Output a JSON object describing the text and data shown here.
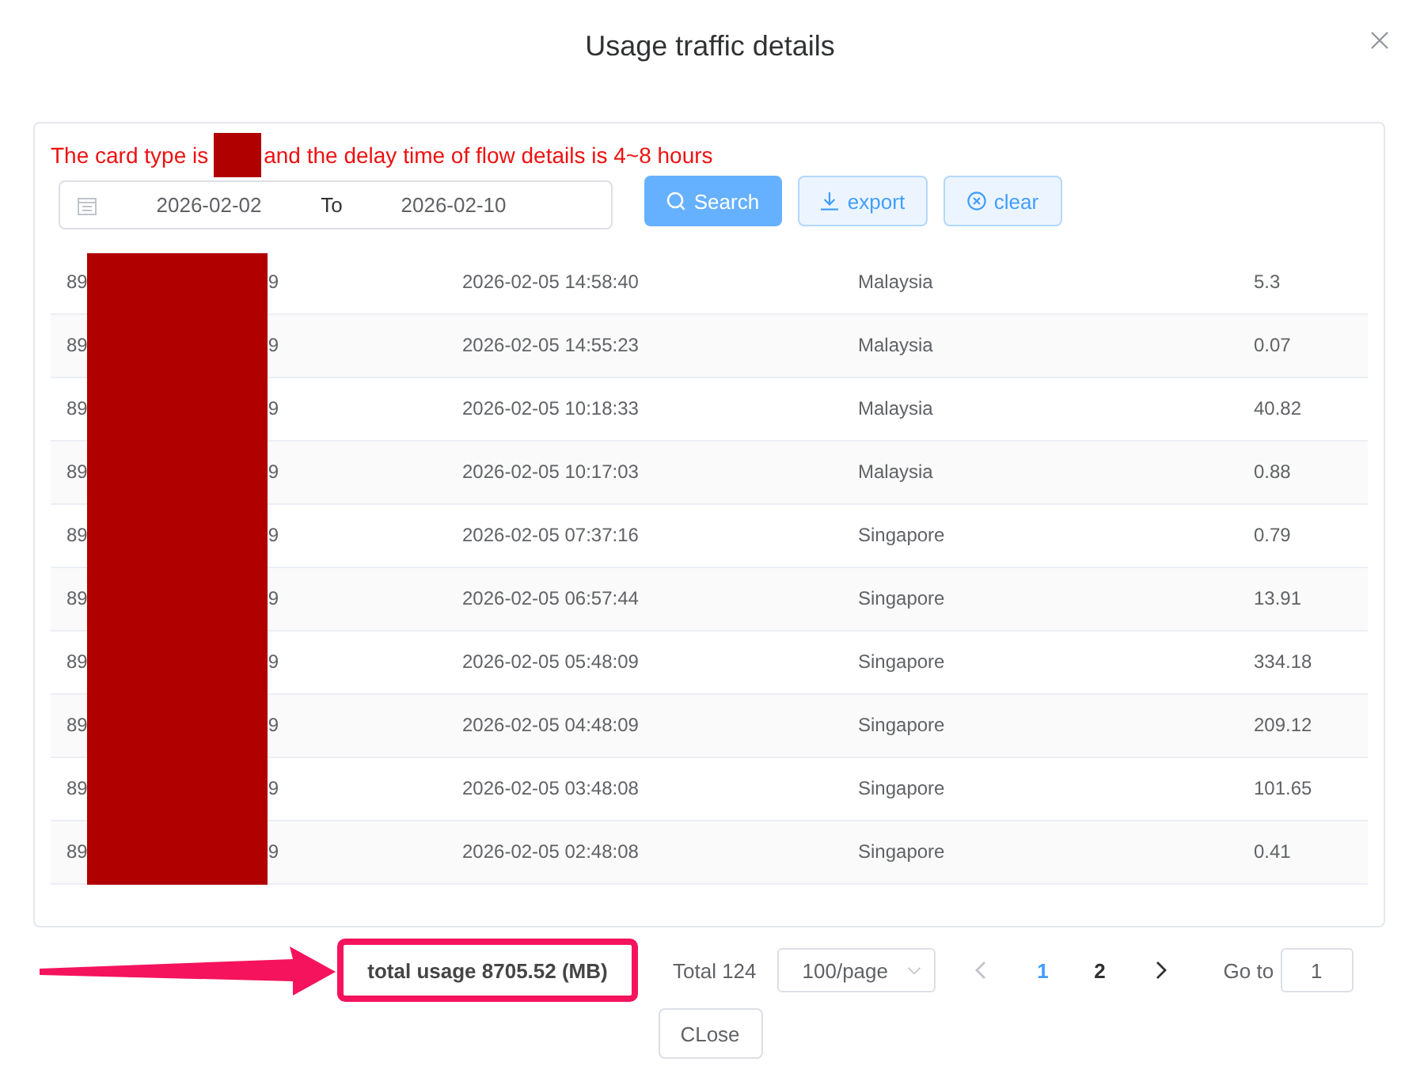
{
  "dialog": {
    "title": "Usage traffic details"
  },
  "notice": {
    "before": "The card type is",
    "redacted": true,
    "after": "and the delay time of flow details is 4~8 hours"
  },
  "filters": {
    "date_range": {
      "start": "2026-02-02",
      "separator": "To",
      "end": "2026-02-10"
    },
    "buttons": [
      {
        "kind": "search",
        "label": "Search"
      },
      {
        "kind": "export",
        "label": "export"
      },
      {
        "kind": "clear",
        "label": "clear"
      }
    ]
  },
  "table": {
    "redacted": true,
    "rows": [
      {
        "column_1": [
          "89",
          "9"
        ],
        "column_2": "2026-02-05 14:58:40",
        "column_3": "Malaysia",
        "column_4": "5.3"
      },
      {
        "column_1": [
          "89",
          "9"
        ],
        "column_2": "2026-02-05 14:55:23",
        "column_3": "Malaysia",
        "column_4": "0.07"
      },
      {
        "column_1": [
          "89",
          "9"
        ],
        "column_2": "2026-02-05 10:18:33",
        "column_3": "Malaysia",
        "column_4": "40.82"
      },
      {
        "column_1": [
          "89",
          "9"
        ],
        "column_2": "2026-02-05 10:17:03",
        "column_3": "Malaysia",
        "column_4": "0.88"
      },
      {
        "column_1": [
          "89",
          "9"
        ],
        "column_2": "2026-02-05 07:37:16",
        "column_3": "Singapore",
        "column_4": "0.79"
      },
      {
        "column_1": [
          "89",
          "9"
        ],
        "column_2": "2026-02-05 06:57:44",
        "column_3": "Singapore",
        "column_4": "13.91"
      },
      {
        "column_1": [
          "89",
          "9"
        ],
        "column_2": "2026-02-05 05:48:09",
        "column_3": "Singapore",
        "column_4": "334.18"
      },
      {
        "column_1": [
          "89",
          "9"
        ],
        "column_2": "2026-02-05 04:48:09",
        "column_3": "Singapore",
        "column_4": "209.12"
      },
      {
        "column_1": [
          "89",
          "9"
        ],
        "column_2": "2026-02-05 03:48:08",
        "column_3": "Singapore",
        "column_4": "101.65"
      },
      {
        "column_1": [
          "89",
          "9"
        ],
        "column_2": "2026-02-05 02:48:08",
        "column_3": "Singapore",
        "column_4": "0.41"
      }
    ]
  },
  "footer": {
    "total_usage": "total usage 8705.52 (MB)",
    "highlighted": true
  },
  "pagination": {
    "total": "Total 124",
    "page_size": "100/page",
    "prev_disabled": true,
    "pages": [
      {
        "label": "1",
        "selected": true
      },
      {
        "label": "2",
        "selected": false
      }
    ],
    "next_disabled": false,
    "goto_label": "Go to",
    "goto_value": "1"
  },
  "close_button": "CLose"
}
